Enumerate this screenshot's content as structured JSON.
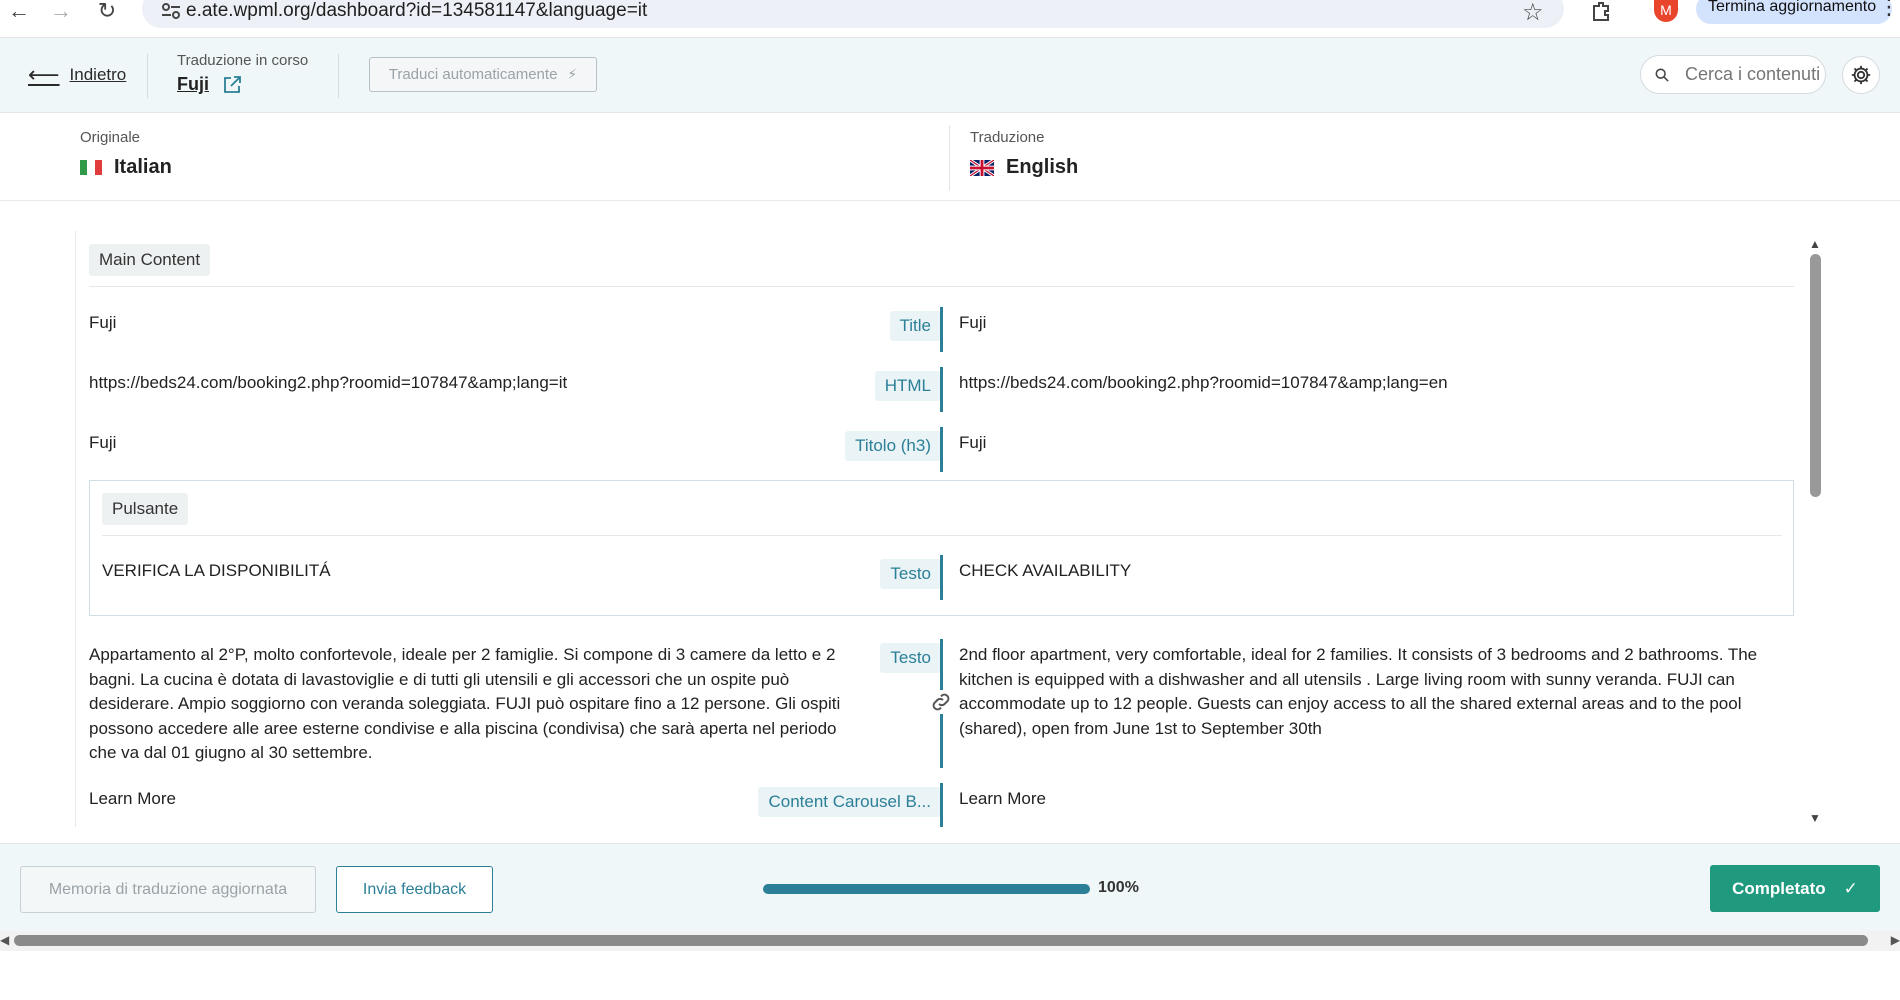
{
  "browser": {
    "url": "e.ate.wpml.org/dashboard?id=134581147&language=it",
    "avatar_letter": "M",
    "update_button": "Termina aggiornamento"
  },
  "header": {
    "back_label": "Indietro",
    "progress_label": "Traduzione in corso",
    "doc_title": "Fuji",
    "auto_translate_label": "Traduci automaticamente",
    "search_placeholder": "Cerca i contenuti"
  },
  "languages": {
    "source_caption": "Originale",
    "source_name": "Italian",
    "target_caption": "Traduzione",
    "target_name": "English"
  },
  "sections": {
    "main": "Main Content",
    "button_group": "Pulsante"
  },
  "rows": [
    {
      "source": "Fuji",
      "field": "Title",
      "target": "Fuji"
    },
    {
      "source": "https://beds24.com/booking2.php?roomid=107847&amp;lang=it",
      "field": "HTML",
      "target": "https://beds24.com/booking2.php?roomid=107847&amp;lang=en"
    },
    {
      "source": "Fuji",
      "field": "Titolo (h3)",
      "target": "Fuji"
    },
    {
      "source": "VERIFICA LA DISPONIBILITÁ",
      "field": "Testo",
      "target": "CHECK AVAILABILITY"
    },
    {
      "source": "Appartamento al 2°P, molto confortevole, ideale per 2 famiglie. Si compone di 3 camere da letto e 2 bagni. La cucina è dotata di lavastoviglie e di tutti gli utensili e gli accessori che un ospite può desiderare. Ampio soggiorno con veranda soleggiata. FUJI può ospitare fino a 12 persone. Gli ospiti possono accedere alle aree esterne condivise e alla piscina (condivisa) che sarà aperta nel periodo che va dal 01 giugno al 30 settembre.",
      "field": "Testo",
      "target": "2nd floor apartment, very comfortable, ideal for 2 families. It consists of 3 bedrooms and 2 bathrooms. The kitchen is equipped with a dishwasher and all utensils . Large living room with sunny veranda. FUJI can accommodate up to 12 people. Guests can enjoy access to all the shared external areas and to the pool (shared), open from June 1st to September 30th"
    },
    {
      "source": "Learn More",
      "field": "Content Carousel B...",
      "target": "Learn More"
    }
  ],
  "footer": {
    "tm_button": "Memoria di traduzione aggiornata",
    "feedback_button": "Invia feedback",
    "progress_value": 100,
    "progress_text": "100%",
    "complete_button": "Completato"
  },
  "colors": {
    "accent": "#2b7f97",
    "complete": "#1f9a7f",
    "header_bg": "#f0f7f9"
  }
}
